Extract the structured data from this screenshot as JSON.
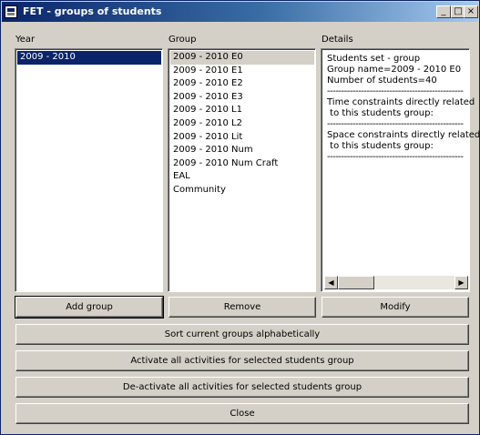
{
  "window": {
    "title": "FET - groups of students",
    "icons": [
      "fet-app-icon",
      "minimize-icon",
      "maximize-icon",
      "close-icon"
    ]
  },
  "year": {
    "label": "Year",
    "items": [
      "2009 - 2010"
    ],
    "selected": "2009 - 2010"
  },
  "group": {
    "label": "Group",
    "items": [
      "2009 - 2010 E0",
      "2009 - 2010 E1",
      "2009 - 2010 E2",
      "2009 - 2010 E3",
      "2009 - 2010 L1",
      "2009 - 2010 L2",
      "2009 - 2010 Lit",
      "2009 - 2010 Num",
      "2009 - 2010 Num Craft",
      "EAL",
      "Community"
    ],
    "selected": "2009 - 2010 E0"
  },
  "details": {
    "label": "Details",
    "lines": [
      "Students set - group",
      "Group name=2009 - 2010 E0",
      "Number of students=40",
      "--------------------------------------------------",
      "Time constraints directly related",
      " to this students group:",
      "--------------------------------------------------",
      "Space constraints directly related",
      " to this students group:",
      "--------------------------------------------------"
    ]
  },
  "buttons": {
    "add_group": "Add group",
    "remove": "Remove",
    "modify": "Modify",
    "sort": "Sort current groups alphabetically",
    "activate": "Activate all activities for selected students group",
    "deactivate": "De-activate all activities for selected students group",
    "close": "Close"
  }
}
